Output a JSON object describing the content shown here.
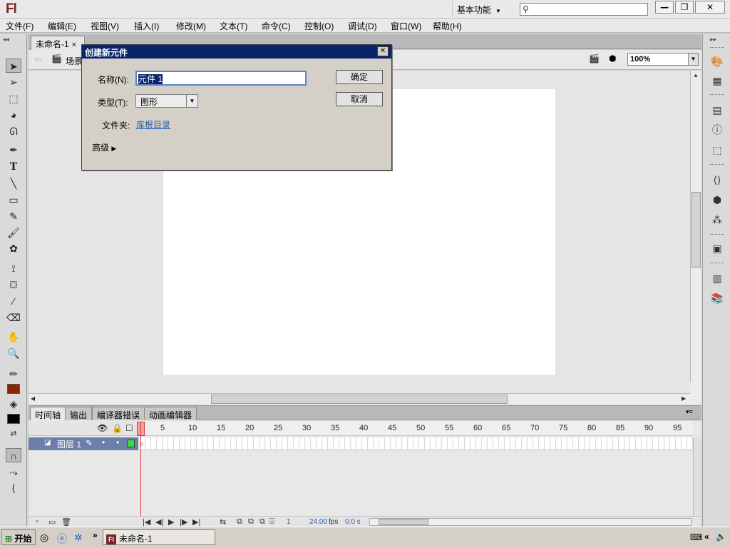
{
  "app": {
    "logo": "Fl",
    "workspace": "基本功能",
    "search_placeholder": ""
  },
  "window_buttons": {
    "minimize": "—",
    "restore": "❐",
    "close": "✕"
  },
  "menubar": [
    "文件(F)",
    "编辑(E)",
    "视图(V)",
    "插入(I)",
    "修改(M)",
    "文本(T)",
    "命令(C)",
    "控制(O)",
    "调试(D)",
    "窗口(W)",
    "帮助(H)"
  ],
  "document": {
    "tab_label": "未命名-1",
    "scene_label": "场景",
    "zoom": "100%"
  },
  "dialog": {
    "title": "创建新元件",
    "name_label": "名称(N):",
    "name_value": "元件 1",
    "type_label": "类型(T):",
    "type_value": "图形",
    "folder_label": "文件夹:",
    "folder_value": "库根目录",
    "advanced_label": "高级",
    "ok_button": "确定",
    "cancel_button": "取消"
  },
  "timeline": {
    "tabs": [
      "时间轴",
      "输出",
      "编译器错误",
      "动画编辑器"
    ],
    "ruler_marks": [
      "1",
      "5",
      "10",
      "15",
      "20",
      "25",
      "30",
      "35",
      "40",
      "45",
      "50",
      "55",
      "60",
      "65",
      "70",
      "75",
      "80",
      "85",
      "90",
      "95"
    ],
    "layer_name": "图层 1",
    "current_frame": "1",
    "fps": "24.00",
    "fps_unit": "fps",
    "elapsed": "0.0 s"
  },
  "tools": {
    "stroke_color": "#000000",
    "fill_color": "#8b2500",
    "fill_color2": "#000000"
  },
  "taskbar": {
    "start": "开始",
    "window_item": "未命名-1",
    "chevron": "»"
  }
}
